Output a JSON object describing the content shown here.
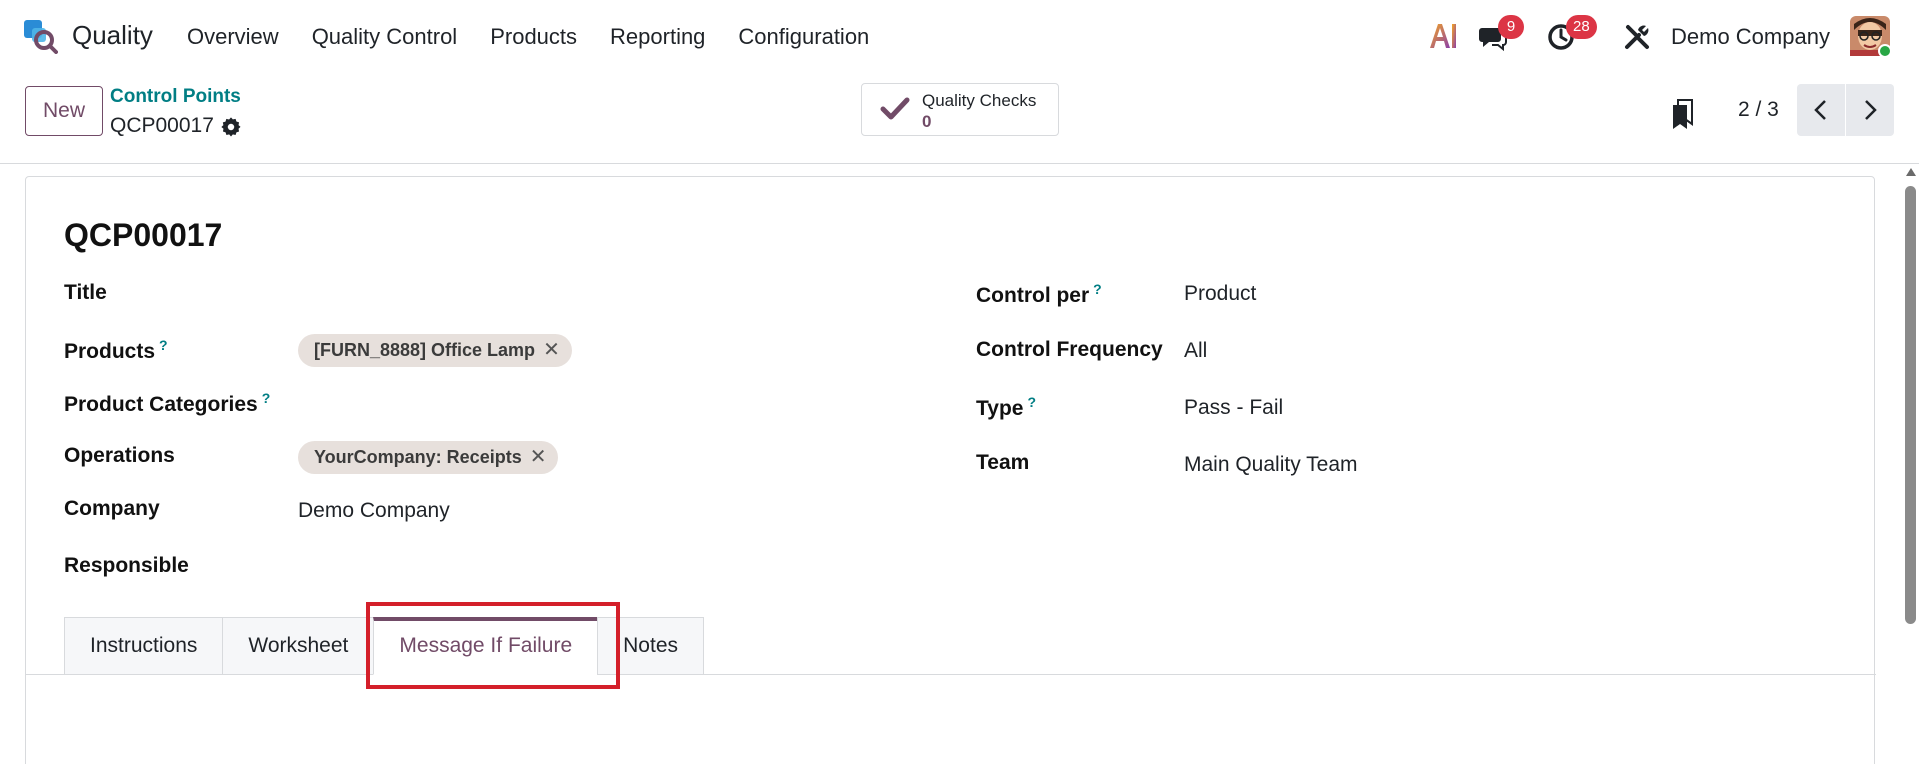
{
  "app": {
    "name": "Quality"
  },
  "nav": {
    "menu": [
      "Overview",
      "Quality Control",
      "Products",
      "Reporting",
      "Configuration"
    ],
    "ai_label": "AI",
    "messages_count": "9",
    "activities_count": "28",
    "company": "Demo Company"
  },
  "control_panel": {
    "new_label": "New",
    "breadcrumb": "Control Points",
    "record_name": "QCP00017",
    "smart_button": {
      "label": "Quality Checks",
      "value": "0"
    },
    "pager": "2 / 3"
  },
  "form": {
    "title": "QCP00017",
    "left_fields": {
      "title_label": "Title",
      "products_label": "Products",
      "products_tag": "[FURN_8888] Office Lamp",
      "product_categories_label": "Product Categories",
      "operations_label": "Operations",
      "operations_tag": "YourCompany: Receipts",
      "company_label": "Company",
      "company_value": "Demo Company",
      "responsible_label": "Responsible"
    },
    "right_fields": {
      "control_per_label": "Control per",
      "control_per_value": "Product",
      "control_frequency_label": "Control Frequency",
      "control_frequency_value": "All",
      "type_label": "Type",
      "type_value": "Pass - Fail",
      "team_label": "Team",
      "team_value": "Main Quality Team"
    },
    "help_mark": "?",
    "tabs": [
      "Instructions",
      "Worksheet",
      "Message If Failure",
      "Notes"
    ],
    "active_tab": "Message If Failure"
  },
  "colors": {
    "brand": "#714b67",
    "link": "#017e84",
    "badge": "#dc3545",
    "highlight": "#d41f2a"
  }
}
